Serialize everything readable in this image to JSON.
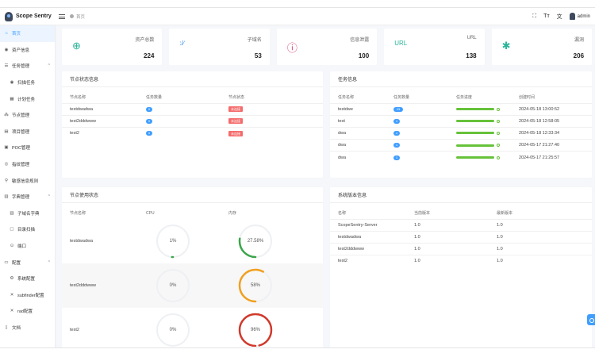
{
  "app": {
    "title": "Scope Sentry"
  },
  "breadcrumb": {
    "current": "首页"
  },
  "header": {
    "icons": [
      "fullscreen-icon",
      "font-size-icon",
      "language-icon"
    ],
    "user": "admin"
  },
  "sidebar": {
    "items": [
      {
        "label": "首页",
        "icon": "home-icon",
        "active": true
      },
      {
        "label": "资产信息",
        "icon": "eye-icon"
      },
      {
        "label": "任务管理",
        "icon": "list-icon",
        "group": true
      },
      {
        "label": "扫描任务",
        "icon": "eye-icon",
        "sub": true
      },
      {
        "label": "计划任务",
        "icon": "calendar-icon",
        "sub": true
      },
      {
        "label": "节点管理",
        "icon": "node-icon"
      },
      {
        "label": "项目管理",
        "icon": "project-icon"
      },
      {
        "label": "POC管理",
        "icon": "poc-icon"
      },
      {
        "label": "指纹管理",
        "icon": "fingerprint-icon"
      },
      {
        "label": "敏感信息规则",
        "icon": "rule-icon"
      },
      {
        "label": "字典管理",
        "icon": "dict-icon",
        "group": true
      },
      {
        "label": "子域名字典",
        "icon": "dict-icon",
        "sub": true
      },
      {
        "label": "目录扫描",
        "icon": "folder-icon",
        "sub": true
      },
      {
        "label": "端口",
        "icon": "port-icon",
        "sub": true
      },
      {
        "label": "配置",
        "icon": "config-icon",
        "group": true
      },
      {
        "label": "系统配置",
        "icon": "gear-icon",
        "sub": true
      },
      {
        "label": "subfinder配置",
        "icon": "tool-icon",
        "sub": true
      },
      {
        "label": "rad配置",
        "icon": "tool-icon",
        "sub": true
      },
      {
        "label": "文档",
        "icon": "doc-icon"
      }
    ]
  },
  "stats": [
    {
      "label": "资产总数",
      "value": "224",
      "icon": "globe-icon",
      "color": "#2bb59a"
    },
    {
      "label": "子域名",
      "value": "53",
      "icon": "subdomain-icon",
      "color": "#3a8ee6"
    },
    {
      "label": "信息泄露",
      "value": "100",
      "icon": "info-icon",
      "color": "#d23b6b"
    },
    {
      "label": "URL",
      "value": "138",
      "icon": "url-icon",
      "color": "#2bb59a"
    },
    {
      "label": "漏洞",
      "value": "206",
      "icon": "bug-icon",
      "color": "#2bb59a"
    }
  ],
  "node_status": {
    "title": "节点状态信息",
    "columns": [
      "节点名称",
      "任务数量",
      "节点状态"
    ],
    "rows": [
      {
        "name": "testdwadwa",
        "tasks": "0",
        "status": "未连接"
      },
      {
        "name": "test2dddwww",
        "tasks": "0",
        "status": "未连接"
      },
      {
        "name": "test2",
        "tasks": "0",
        "status": "未连接"
      }
    ]
  },
  "tasks": {
    "title": "任务信息",
    "columns": [
      "任务名称",
      "任务数量",
      "任务进度",
      "创建时间"
    ],
    "rows": [
      {
        "name": "testdwe",
        "count": "23",
        "progress": 1.0,
        "created": "2024-05-18 13:00:52"
      },
      {
        "name": "test",
        "count": "1",
        "progress": 1.0,
        "created": "2024-05-18 12:58:05"
      },
      {
        "name": "dwa",
        "count": "1",
        "progress": 1.0,
        "created": "2024-05-18 12:33:34"
      },
      {
        "name": "dwa",
        "count": "1",
        "progress": 1.0,
        "created": "2024-05-17 21:27:40"
      },
      {
        "name": "dwa",
        "count": "1",
        "progress": 1.0,
        "created": "2024-05-17 21:25:57"
      }
    ]
  },
  "node_usage": {
    "title": "节点使用状态",
    "columns": [
      "节点名称",
      "CPU",
      "内存"
    ],
    "rows": [
      {
        "name": "testdwadwa",
        "cpu": "1%",
        "cpu_value": 1,
        "mem": "27.58%",
        "mem_value": 27.58,
        "mem_color": "#3aa54a"
      },
      {
        "name": "test2dddwww",
        "cpu": "0%",
        "cpu_value": 0,
        "mem": "58%",
        "mem_value": 58,
        "mem_color": "#f0a020"
      },
      {
        "name": "test2",
        "cpu": "0%",
        "cpu_value": 0,
        "mem": "96%",
        "mem_value": 96,
        "mem_color": "#d0392b"
      }
    ]
  },
  "versions": {
    "title": "系统版本信息",
    "columns": [
      "名称",
      "当前版本",
      "最新版本"
    ],
    "rows": [
      {
        "name": "ScopeSentry-Server",
        "current": "1.0",
        "latest": "1.0"
      },
      {
        "name": "testdwadwa",
        "current": "1.0",
        "latest": "1.0"
      },
      {
        "name": "test2dddwww",
        "current": "1.0",
        "latest": "1.0"
      },
      {
        "name": "test2",
        "current": "1.0",
        "latest": "1.0"
      }
    ]
  }
}
